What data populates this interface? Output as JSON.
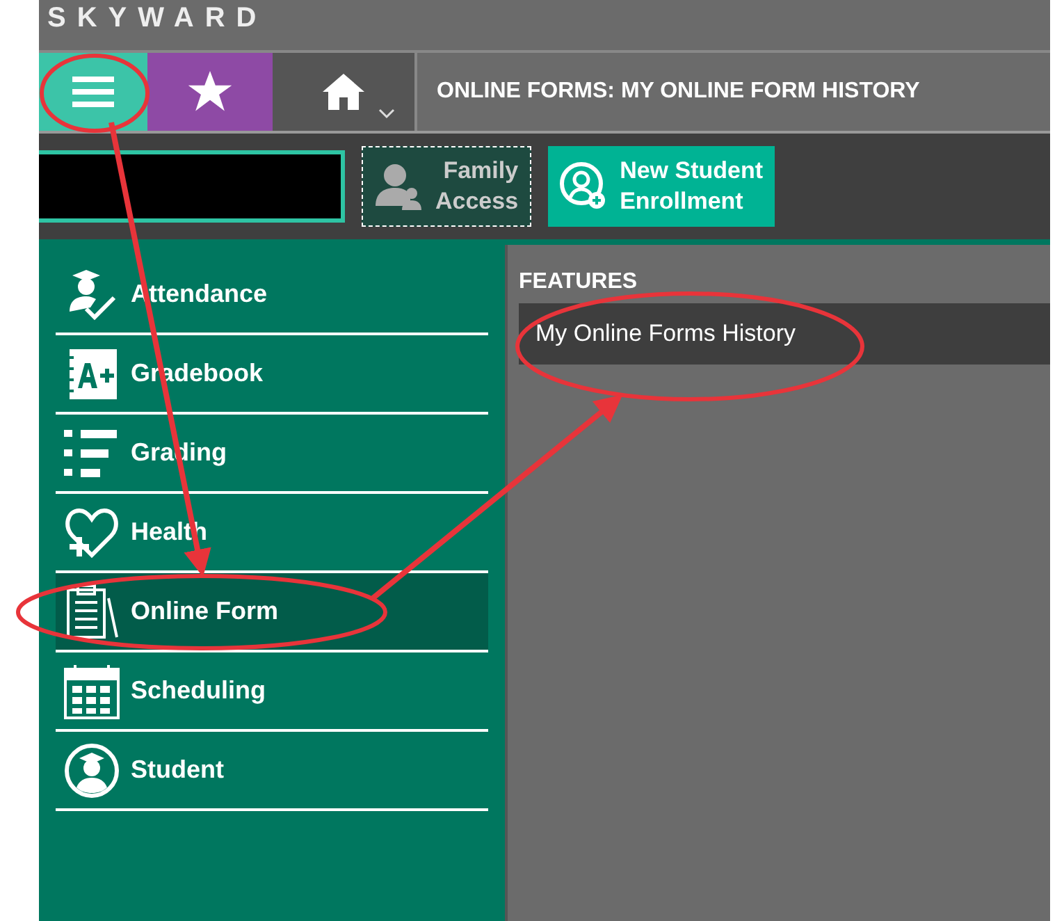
{
  "logo": {
    "text": "SKYWARD"
  },
  "nav": {
    "title": "ONLINE FORMS: MY ONLINE FORM HISTORY"
  },
  "toolbar": {
    "buttons": [
      {
        "kind": "outline",
        "label_lines": [
          "Family",
          "Access"
        ]
      },
      {
        "kind": "filled",
        "label_lines": [
          "New Student",
          "Enrollment"
        ]
      }
    ]
  },
  "sidebar": {
    "items": [
      {
        "label": "Attendance",
        "kind": "attendance",
        "selected": false
      },
      {
        "label": "Gradebook",
        "kind": "gradebook",
        "selected": false
      },
      {
        "label": "Grading",
        "kind": "grading",
        "selected": false
      },
      {
        "label": "Health",
        "kind": "health",
        "selected": false
      },
      {
        "label": "Online Form",
        "kind": "form",
        "selected": true
      },
      {
        "label": "Scheduling",
        "kind": "calendar",
        "selected": false
      },
      {
        "label": "Student",
        "kind": "student",
        "selected": false
      }
    ]
  },
  "features": {
    "heading": "FEATURES",
    "items": [
      {
        "label": "My Online Forms History"
      }
    ]
  }
}
